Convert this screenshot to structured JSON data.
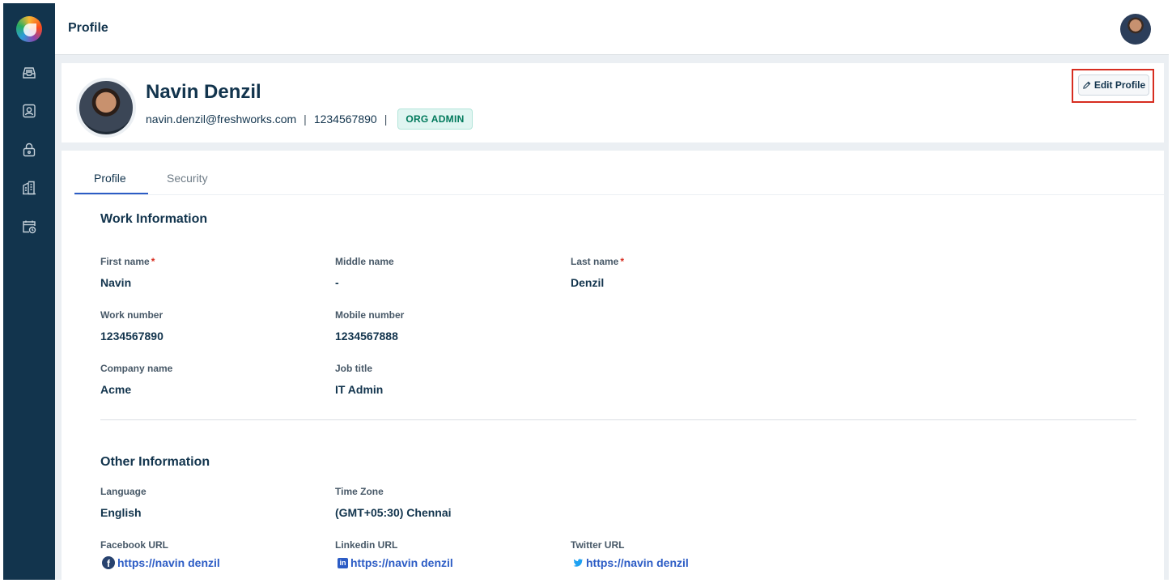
{
  "topbar": {
    "title": "Profile"
  },
  "header": {
    "name": "Navin Denzil",
    "email": "navin.denzil@freshworks.com",
    "separator": "|",
    "phone": "1234567890",
    "role_badge": "ORG ADMIN",
    "edit_button": "Edit Profile"
  },
  "tabs": [
    {
      "label": "Profile",
      "active": true
    },
    {
      "label": "Security",
      "active": false
    }
  ],
  "work_info": {
    "title": "Work Information",
    "fields": {
      "first_name": {
        "label": "First name",
        "value": "Navin",
        "required": "*"
      },
      "middle_name": {
        "label": "Middle name",
        "value": "-"
      },
      "last_name": {
        "label": "Last name",
        "value": "Denzil",
        "required": "*"
      },
      "work_number": {
        "label": "Work number",
        "value": "1234567890"
      },
      "mobile_number": {
        "label": "Mobile number",
        "value": "1234567888"
      },
      "company_name": {
        "label": "Company name",
        "value": "Acme"
      },
      "job_title": {
        "label": "Job title",
        "value": "IT Admin"
      }
    }
  },
  "other_info": {
    "title": "Other Information",
    "fields": {
      "language": {
        "label": "Language",
        "value": "English"
      },
      "time_zone": {
        "label": "Time Zone",
        "value": "(GMT+05:30) Chennai"
      },
      "facebook": {
        "label": "Facebook URL",
        "value": "https://navin denzil",
        "icon": "facebook-icon"
      },
      "linkedin": {
        "label": "Linkedin URL",
        "value": "https://navin denzil",
        "icon": "linkedin-icon"
      },
      "twitter": {
        "label": "Twitter URL",
        "value": "https://navin denzil",
        "icon": "twitter-icon"
      }
    }
  },
  "sidebar": {
    "icons": [
      "app-logo",
      "inbox-icon",
      "contact-icon",
      "lock-icon",
      "building-icon",
      "calendar-clock-icon"
    ]
  },
  "colors": {
    "sidebar": "#12344d",
    "accent": "#2c5cc5",
    "badge_bg": "#e0f5f1",
    "badge_text": "#00795b",
    "highlight": "#d72d20"
  }
}
